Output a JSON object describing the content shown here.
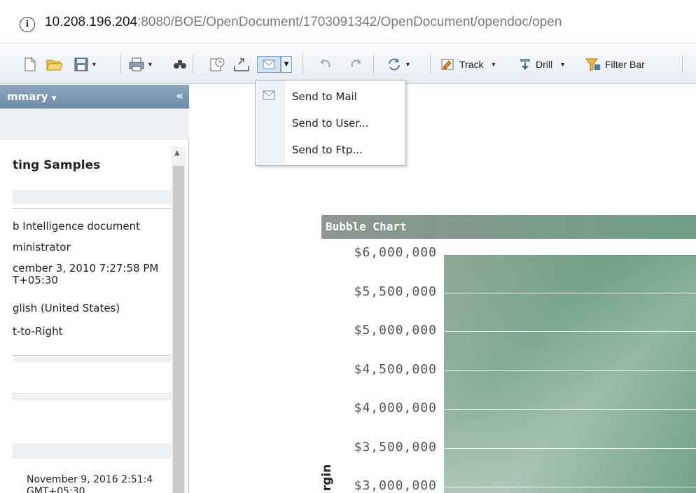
{
  "address_bar": {
    "host": "10.208.196.204",
    "rest": ":8080/BOE/OpenDocument/1703091342/OpenDocument/opendoc/open"
  },
  "toolbar": {
    "track_label": "Track",
    "drill_label": "Drill",
    "filter_bar_label": "Filter Bar"
  },
  "send_menu": {
    "items": [
      "Send to Mail",
      "Send to User...",
      "Send to Ftp..."
    ]
  },
  "left_panel": {
    "header_title": "mmary",
    "collapse_symbol": "«",
    "doc_title": "ting Samples",
    "meta": [
      "b Intelligence document",
      "ministrator",
      "cember 3, 2010 7:27:58 PM",
      "T+05:30",
      "glish (United States)",
      "t-to-Right"
    ],
    "bottom": [
      "November 9, 2016 2:51:4",
      "GMT+05:30"
    ]
  },
  "report": {
    "chart_title": "Bubble Chart",
    "y_axis_label": "rgin"
  },
  "chart_data": {
    "type": "scatter",
    "title": "Bubble Chart",
    "ylabel": "rgin",
    "yticks": [
      "$6,000,000",
      "$5,500,000",
      "$5,000,000",
      "$4,500,000",
      "$4,000,000",
      "$3,500,000",
      "$3,000,000"
    ],
    "ylim": [
      3000000,
      6000000
    ],
    "grid": true
  },
  "colors": {
    "accent": "#6f9f86",
    "panel_header": "#7f9ab5"
  }
}
